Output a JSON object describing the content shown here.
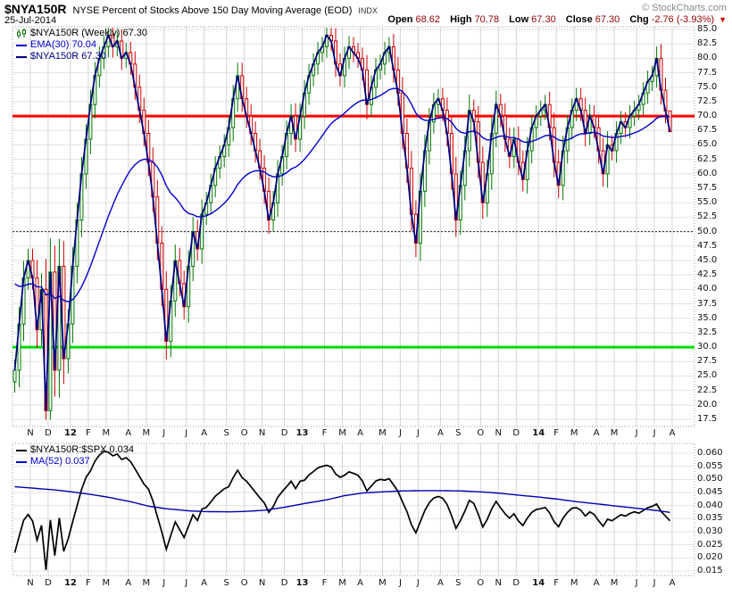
{
  "header": {
    "symbol": "$NYA150R",
    "title": "NYSE Percent of Stocks Above 150 Day Moving Average (EOD)",
    "exchange": "INDX",
    "date": "25-Jul-2014",
    "copyright": "© StockCharts.com",
    "quote": {
      "open_label": "Open",
      "open": "68.62",
      "high_label": "High",
      "high": "70.78",
      "low_label": "Low",
      "low": "67.30",
      "close_label": "Close",
      "close": "67.30",
      "chg_label": "Chg",
      "chg": "-2.76 (-3.93%)",
      "direction": "down",
      "down_arrow": "▼"
    }
  },
  "main_chart": {
    "legend": [
      {
        "label": "$NYA150R (Weekly) 67.30",
        "color": "#000000",
        "icon": "candlestick-icon"
      },
      {
        "label": "EMA(30) 70.04",
        "color": "#0000CC",
        "icon": "line-swatch"
      },
      {
        "label": "$NYA150R 67.30",
        "color": "#000080",
        "icon": "line-swatch"
      }
    ]
  },
  "ratio_chart": {
    "legend": [
      {
        "label": "$NYA150R:$SPX 0.034",
        "color": "#000000",
        "icon": "line-swatch"
      },
      {
        "label": "MA(52) 0.037",
        "color": "#0000CC",
        "icon": "line-swatch"
      }
    ]
  },
  "chart_data": [
    {
      "type": "candlestick",
      "title": "$NYA150R Weekly percent of NYSE stocks above 150-day MA",
      "ylim": [
        17.5,
        85.0
      ],
      "y_ticks": [
        "85.0",
        "82.5",
        "80.0",
        "77.5",
        "75.0",
        "72.5",
        "70.0",
        "67.5",
        "65.0",
        "62.5",
        "60.0",
        "57.5",
        "55.0",
        "52.5",
        "50.0",
        "47.5",
        "45.0",
        "42.5",
        "40.0",
        "37.5",
        "35.0",
        "32.5",
        "30.0",
        "27.5",
        "25.0",
        "22.5",
        "20.0",
        "17.5"
      ],
      "x_labels": [
        "N",
        "D",
        "12",
        "F",
        "M",
        "A",
        "M",
        "J",
        "J",
        "A",
        "S",
        "O",
        "N",
        "D",
        "13",
        "F",
        "M",
        "A",
        "M",
        "J",
        "J",
        "A",
        "S",
        "O",
        "N",
        "D",
        "14",
        "F",
        "M",
        "A",
        "M",
        "J",
        "J",
        "A"
      ],
      "weeks_per_month": [
        4,
        4,
        5,
        4,
        4,
        5,
        4,
        4,
        5,
        4,
        5,
        4,
        4,
        5,
        4,
        5,
        4,
        4,
        5,
        4,
        4,
        5,
        4,
        5,
        4,
        4,
        5,
        4,
        4,
        5,
        4,
        5,
        4,
        4
      ],
      "grid": true,
      "legend_position": "top-left",
      "series": [
        {
          "name": "$NYA150R (Weekly)",
          "type": "candlestick",
          "up_color": "#007700",
          "down_color": "#CC0000",
          "closes": [
            26,
            34,
            42,
            45,
            42,
            33,
            40,
            19,
            43,
            26,
            44,
            28,
            34,
            44,
            52,
            60,
            66,
            72,
            77,
            80,
            82,
            84,
            82,
            83,
            80,
            81,
            79,
            75,
            71,
            67,
            62,
            56,
            48,
            40,
            31,
            38,
            45,
            41,
            37,
            44,
            50,
            47,
            53,
            55,
            58,
            61,
            63,
            65,
            68,
            73,
            77,
            73,
            70,
            67,
            64,
            61,
            57,
            52,
            55,
            60,
            63,
            67,
            70,
            66,
            70,
            74,
            77,
            79,
            81,
            82,
            84,
            83,
            79,
            77,
            80,
            82,
            81,
            80,
            78,
            72,
            75,
            78,
            79,
            81,
            82,
            78,
            74,
            67,
            61,
            53,
            48,
            57,
            64,
            69,
            72,
            73,
            71,
            67,
            60,
            52,
            58,
            64,
            71,
            69,
            62,
            55,
            60,
            67,
            72,
            70,
            66,
            63,
            66,
            62,
            59,
            64,
            68,
            70,
            71,
            72,
            68,
            62,
            58,
            64,
            68,
            71,
            73,
            71,
            67,
            70,
            68,
            64,
            60,
            65,
            64,
            67,
            69,
            68,
            70,
            71,
            72,
            74,
            76,
            77,
            80,
            74.5,
            70.9,
            67.3
          ],
          "last_candle": {
            "open": 68.62,
            "high": 70.78,
            "low": 67.3,
            "close": 67.3
          }
        },
        {
          "name": "EMA(30)",
          "type": "line",
          "derived": "ema",
          "period": 30,
          "seed": 42,
          "last_value": 70.04,
          "color": "#0000CC"
        },
        {
          "name": "$NYA150R close line",
          "type": "line",
          "source": "closes",
          "last_value": 67.3,
          "color": "#000080"
        }
      ],
      "overlays": [
        {
          "type": "hline",
          "value": 70.0,
          "color": "#FF0000",
          "width": 3,
          "style": "solid"
        },
        {
          "type": "hline",
          "value": 50.0,
          "color": "#222222",
          "width": 1,
          "style": "dashed"
        },
        {
          "type": "hline",
          "value": 30.0,
          "color": "#00DD00",
          "width": 3,
          "style": "solid"
        }
      ]
    },
    {
      "type": "line",
      "title": "$NYA150R:$SPX ratio",
      "ylim": [
        0.015,
        0.06
      ],
      "y_ticks": [
        "0.060",
        "0.055",
        "0.050",
        "0.045",
        "0.040",
        "0.035",
        "0.030",
        "0.025",
        "0.020",
        "0.015"
      ],
      "grid": true,
      "legend_position": "top-left",
      "series": [
        {
          "name": "$NYA150R:$SPX",
          "color": "#000000",
          "last_value": 0.034,
          "values": [
            0.022,
            0.0283,
            0.0344,
            0.0366,
            0.0341,
            0.0268,
            0.0325,
            0.0154,
            0.0345,
            0.0209,
            0.0353,
            0.0225,
            0.0273,
            0.0338,
            0.04,
            0.0462,
            0.0508,
            0.0533,
            0.057,
            0.0593,
            0.0607,
            0.0604,
            0.059,
            0.0597,
            0.0576,
            0.0583,
            0.0568,
            0.054,
            0.0511,
            0.0482,
            0.0463,
            0.0418,
            0.0358,
            0.0299,
            0.0233,
            0.0286,
            0.0338,
            0.0308,
            0.0278,
            0.0321,
            0.0365,
            0.0343,
            0.0387,
            0.0393,
            0.0414,
            0.0436,
            0.045,
            0.0464,
            0.0472,
            0.0507,
            0.0535,
            0.0507,
            0.0493,
            0.0472,
            0.0451,
            0.043,
            0.041,
            0.0374,
            0.0396,
            0.0432,
            0.0453,
            0.0472,
            0.0493,
            0.0465,
            0.0493,
            0.0497,
            0.0517,
            0.053,
            0.0544,
            0.055,
            0.0554,
            0.0548,
            0.0521,
            0.0508,
            0.0516,
            0.0529,
            0.0523,
            0.0516,
            0.0494,
            0.0456,
            0.0475,
            0.0494,
            0.05,
            0.0497,
            0.0503,
            0.0479,
            0.0454,
            0.0414,
            0.0377,
            0.0327,
            0.0296,
            0.0339,
            0.0381,
            0.0411,
            0.0429,
            0.0435,
            0.0428,
            0.0404,
            0.0361,
            0.0313,
            0.0343,
            0.0379,
            0.042,
            0.0408,
            0.0367,
            0.0318,
            0.0347,
            0.0387,
            0.0416,
            0.0391,
            0.0369,
            0.0352,
            0.0369,
            0.0341,
            0.0324,
            0.0352,
            0.0374,
            0.0385,
            0.0388,
            0.0393,
            0.0372,
            0.0339,
            0.0319,
            0.0352,
            0.0374,
            0.039,
            0.0392,
            0.0382,
            0.036,
            0.0376,
            0.0366,
            0.0342,
            0.0321,
            0.0348,
            0.0342,
            0.0354,
            0.0365,
            0.036,
            0.037,
            0.0376,
            0.0371,
            0.0381,
            0.0392,
            0.0397,
            0.0406,
            0.0378,
            0.036,
            0.0342
          ]
        },
        {
          "name": "MA(52)",
          "color": "#0000AA",
          "last_value": 0.037,
          "anchors": [
            [
              0,
              0.0472
            ],
            [
              9,
              0.046
            ],
            [
              13,
              0.0452
            ],
            [
              17,
              0.0443
            ],
            [
              21,
              0.0432
            ],
            [
              26,
              0.0415
            ],
            [
              30,
              0.0398
            ],
            [
              34,
              0.0388
            ],
            [
              39,
              0.038
            ],
            [
              43,
              0.0377
            ],
            [
              48,
              0.0376
            ],
            [
              52,
              0.0378
            ],
            [
              56,
              0.0382
            ],
            [
              61,
              0.0395
            ],
            [
              65,
              0.0408
            ],
            [
              70,
              0.0422
            ],
            [
              74,
              0.0438
            ],
            [
              78,
              0.0448
            ],
            [
              83,
              0.0453
            ],
            [
              87,
              0.0456
            ],
            [
              91,
              0.0457
            ],
            [
              96,
              0.0457
            ],
            [
              100,
              0.0456
            ],
            [
              105,
              0.0452
            ],
            [
              109,
              0.0447
            ],
            [
              113,
              0.044
            ],
            [
              118,
              0.0432
            ],
            [
              122,
              0.0424
            ],
            [
              126,
              0.0415
            ],
            [
              131,
              0.0406
            ],
            [
              135,
              0.0398
            ],
            [
              140,
              0.0389
            ],
            [
              144,
              0.0381
            ],
            [
              147,
              0.0374
            ]
          ]
        }
      ]
    }
  ]
}
